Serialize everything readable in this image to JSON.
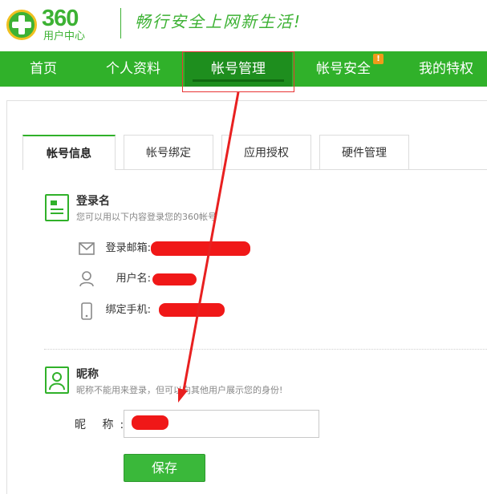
{
  "header": {
    "logo_number": "360",
    "logo_sub": "用户中心",
    "slogan": "畅行安全上网新生活!"
  },
  "nav": {
    "items": [
      {
        "label": "首页"
      },
      {
        "label": "个人资料"
      },
      {
        "label": "帐号管理",
        "active": true
      },
      {
        "label": "帐号安全",
        "badge": "!"
      },
      {
        "label": "我的特权"
      }
    ]
  },
  "tabs": [
    {
      "label": "帐号信息",
      "active": true
    },
    {
      "label": "帐号绑定"
    },
    {
      "label": "应用授权"
    },
    {
      "label": "硬件管理"
    }
  ],
  "login_section": {
    "title": "登录名",
    "desc": "您可以用以下内容登录您的360帐号",
    "rows": [
      {
        "label": "登录邮箱:",
        "icon": "mail-icon"
      },
      {
        "label": "用户名:",
        "icon": "user-icon"
      },
      {
        "label": "绑定手机:",
        "icon": "phone-icon"
      }
    ]
  },
  "nickname_section": {
    "title": "昵称",
    "desc": "昵称不能用来登录，但可以向其他用户展示您的身份!",
    "field_label": "昵  称:",
    "save_label": "保存"
  },
  "colors": {
    "brand_green": "#30b12a",
    "annotation_red": "#e83535"
  }
}
